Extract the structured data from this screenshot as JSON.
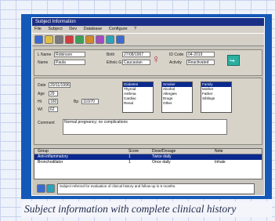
{
  "window": {
    "title": "Subject Information"
  },
  "menu": [
    "File",
    "Subject",
    "Dev",
    "Database",
    "Configure",
    "?"
  ],
  "subject": {
    "name_label": "L Name",
    "name_value": "Robinson",
    "fname_label": "Name",
    "fname_value": "Paula",
    "birth_label": "Birth",
    "birth_value": "27/08/1967",
    "ethnic_label": "Ethnic G",
    "ethnic_value": "Caucasian",
    "id_label": "ID Code",
    "id_value": "04-2019",
    "activity_label": "Activity",
    "activity_value": "Reactivated"
  },
  "visit": {
    "date_label": "Date",
    "date_value": "20/11/1996",
    "age_label": "Age",
    "age_value": "29",
    "ht_label": "Ht",
    "ht_value": "160",
    "wt_label": "Wt",
    "wt_value": "62",
    "bp_label": "Bp",
    "bp_value": "110/70",
    "comment_label": "Comment",
    "comment_value": "Normal pregnancy; no complications"
  },
  "lists": {
    "a": [
      "Diabetes",
      "Thyroid",
      "Asthma",
      "Cardiac",
      "Renal"
    ],
    "b": [
      "Smoker",
      "Alcohol",
      "Allergies",
      "Drugs",
      "Other"
    ],
    "c": [
      "Family",
      "Mother",
      "Father",
      "Siblings"
    ]
  },
  "grid": {
    "date_label": "Date",
    "date_value": "20/11/1996",
    "period_label": "Period",
    "period_value": "20/11/1996 - 20/12/1996",
    "header_group": "Group",
    "header_score": "Score",
    "header_dose": "Dose/Dosage",
    "header_note": "Note",
    "rows": [
      {
        "group": "Anti-inflammatory",
        "score": "1",
        "dose": "Twice daily",
        "note": ""
      },
      {
        "group": "Bronchodilator",
        "score": "1",
        "dose": "Once daily",
        "note": "Inhale"
      }
    ]
  },
  "note": {
    "text": "Subject referred for evaluation of clinical history and follow-up in 6 months."
  },
  "caption": "Subject information with complete clinical history"
}
